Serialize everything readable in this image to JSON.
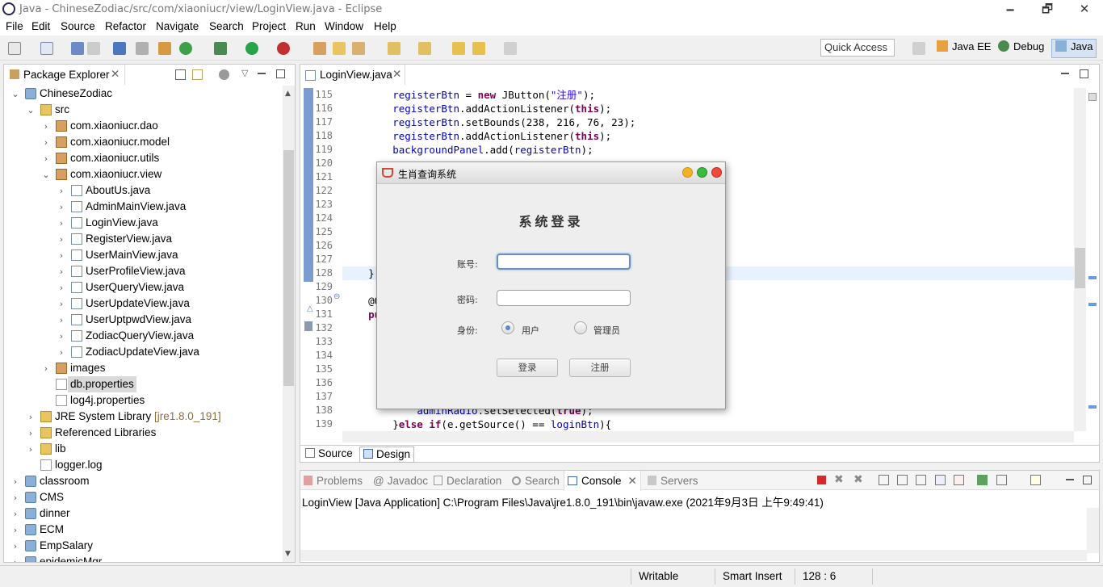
{
  "window": {
    "title": "Java - ChineseZodiac/src/com/xiaoniucr/view/LoginView.java - Eclipse",
    "minimize": "🗕",
    "restore": "🗗",
    "close": "✕"
  },
  "menu": [
    "File",
    "Edit",
    "Source",
    "Refactor",
    "Navigate",
    "Search",
    "Project",
    "Run",
    "Window",
    "Help"
  ],
  "toolbar": {
    "quick_access": "Quick Access",
    "perspectives": [
      "Java EE",
      "Debug",
      "Java"
    ]
  },
  "package_explorer": {
    "title": "Package Explorer",
    "tree": [
      {
        "label": "ChineseZodiac",
        "depth": 0,
        "icon": "project",
        "expanded": true
      },
      {
        "label": "src",
        "depth": 1,
        "icon": "src-folder",
        "expanded": true
      },
      {
        "label": "com.xiaoniucr.dao",
        "depth": 2,
        "icon": "package",
        "expanded": false
      },
      {
        "label": "com.xiaoniucr.model",
        "depth": 2,
        "icon": "package",
        "expanded": false
      },
      {
        "label": "com.xiaoniucr.utils",
        "depth": 2,
        "icon": "package",
        "expanded": false
      },
      {
        "label": "com.xiaoniucr.view",
        "depth": 2,
        "icon": "package",
        "expanded": true
      },
      {
        "label": "AboutUs.java",
        "depth": 3,
        "icon": "java-file",
        "expanded": false
      },
      {
        "label": "AdminMainView.java",
        "depth": 3,
        "icon": "java-file",
        "expanded": false
      },
      {
        "label": "LoginView.java",
        "depth": 3,
        "icon": "java-file",
        "expanded": false
      },
      {
        "label": "RegisterView.java",
        "depth": 3,
        "icon": "java-file",
        "expanded": false
      },
      {
        "label": "UserMainView.java",
        "depth": 3,
        "icon": "java-file",
        "expanded": false
      },
      {
        "label": "UserProfileView.java",
        "depth": 3,
        "icon": "java-file",
        "expanded": false
      },
      {
        "label": "UserQueryView.java",
        "depth": 3,
        "icon": "java-file",
        "expanded": false
      },
      {
        "label": "UserUpdateView.java",
        "depth": 3,
        "icon": "java-file",
        "expanded": false
      },
      {
        "label": "UserUptpwdView.java",
        "depth": 3,
        "icon": "java-file",
        "expanded": false
      },
      {
        "label": "ZodiacQueryView.java",
        "depth": 3,
        "icon": "java-file",
        "expanded": false
      },
      {
        "label": "ZodiacUpdateView.java",
        "depth": 3,
        "icon": "java-file",
        "expanded": false
      },
      {
        "label": "images",
        "depth": 2,
        "icon": "package",
        "expanded": false
      },
      {
        "label": "db.properties",
        "depth": 2,
        "icon": "file",
        "selected": true
      },
      {
        "label": "log4j.properties",
        "depth": 2,
        "icon": "file"
      },
      {
        "label": "JRE System Library",
        "suffix": "[jre1.8.0_191]",
        "depth": 1,
        "icon": "library",
        "expanded": false
      },
      {
        "label": "Referenced Libraries",
        "depth": 1,
        "icon": "library",
        "expanded": false
      },
      {
        "label": "lib",
        "depth": 1,
        "icon": "folder",
        "expanded": false
      },
      {
        "label": "logger.log",
        "depth": 1,
        "icon": "file"
      },
      {
        "label": "classroom",
        "depth": 0,
        "icon": "project",
        "expanded": false
      },
      {
        "label": "CMS",
        "depth": 0,
        "icon": "project",
        "expanded": false
      },
      {
        "label": "dinner",
        "depth": 0,
        "icon": "project",
        "expanded": false
      },
      {
        "label": "ECM",
        "depth": 0,
        "icon": "project",
        "expanded": false
      },
      {
        "label": "EmpSalary",
        "depth": 0,
        "icon": "project",
        "expanded": false
      },
      {
        "label": "epidemicMgr",
        "depth": 0,
        "icon": "project",
        "expanded": false
      }
    ]
  },
  "editor": {
    "tab": "LoginView.java",
    "bottom_tabs": [
      "Source",
      "Design"
    ],
    "lines": [
      {
        "n": "115",
        "html": "        <span class='fld'>registerBtn</span> = <span class='kw'>new</span> JButton(<span class='str'>\"注册\"</span>);"
      },
      {
        "n": "116",
        "html": "        <span class='fld'>registerBtn</span>.addActionListener(<span class='kw'>this</span>);"
      },
      {
        "n": "117",
        "html": "        <span class='fld'>registerBtn</span>.setBounds(238, 216, 76, 23);"
      },
      {
        "n": "118",
        "html": "        <span class='fld'>registerBtn</span>.addActionListener(<span class='kw'>this</span>);"
      },
      {
        "n": "119",
        "html": "        <span class='fld'>backgroundPanel</span>.add(<span class='fld'>registerBtn</span>);"
      },
      {
        "n": "120",
        "html": ""
      },
      {
        "n": "121",
        "html": ""
      },
      {
        "n": "122",
        "html": ""
      },
      {
        "n": "123",
        "html": "                                                      ;"
      },
      {
        "n": "124",
        "html": ""
      },
      {
        "n": "125",
        "html": ""
      },
      {
        "n": "126",
        "html": ""
      },
      {
        "n": "127",
        "html": ""
      },
      {
        "n": "128",
        "html": "    }"
      },
      {
        "n": "129",
        "html": ""
      },
      {
        "n": "130",
        "html": "    @O"
      },
      {
        "n": "131",
        "html": "    <span class='kw'>pu</span>"
      },
      {
        "n": "132",
        "html": ""
      },
      {
        "n": "133",
        "html": ""
      },
      {
        "n": "134",
        "html": ""
      },
      {
        "n": "135",
        "html": ""
      },
      {
        "n": "136",
        "html": ""
      },
      {
        "n": "137",
        "html": ""
      },
      {
        "n": "138",
        "html": "            <span class='fld'>adminRadio</span>.setSelected(<span class='kw'>true</span>);"
      },
      {
        "n": "139",
        "html": "        }<span class='kw'>else if</span>(e.getSource() == <span class='fld'>loginBtn</span>){"
      }
    ]
  },
  "dialog": {
    "title": "生肖查询系统",
    "heading": "系统登录",
    "account_label": "账号:",
    "password_label": "密码:",
    "identity_label": "身份:",
    "radio_user": "用户",
    "radio_admin": "管理员",
    "login_button": "登录",
    "register_button": "注册"
  },
  "console": {
    "tabs": [
      "Problems",
      "Javadoc",
      "Declaration",
      "Search",
      "Console",
      "Servers"
    ],
    "active": "Console",
    "output": "LoginView [Java Application] C:\\Program Files\\Java\\jre1.8.0_191\\bin\\javaw.exe (2021年9月3日 上午9:49:41)"
  },
  "status": {
    "writable": "Writable",
    "insert_mode": "Smart Insert",
    "position": "128 : 6"
  }
}
